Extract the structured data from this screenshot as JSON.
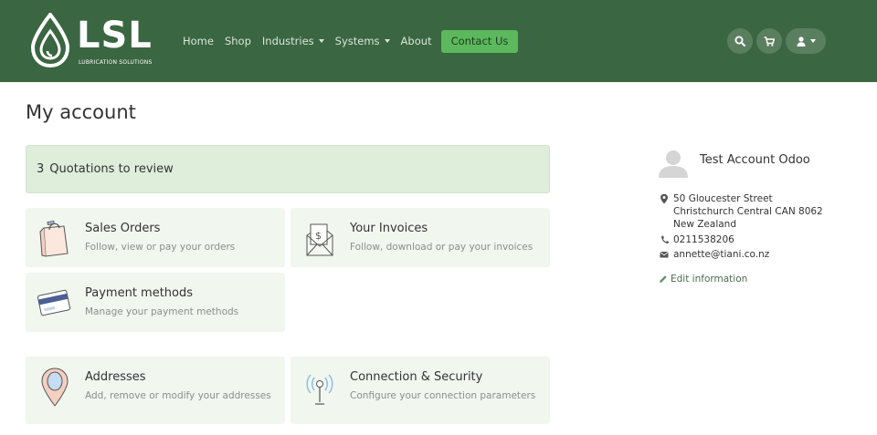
{
  "brand": {
    "name": "LSL",
    "tagline": "LUBRICATION SOLUTIONS"
  },
  "nav": {
    "items": [
      {
        "label": "Home"
      },
      {
        "label": "Shop"
      },
      {
        "label": "Industries"
      },
      {
        "label": "Systems"
      },
      {
        "label": "About"
      }
    ],
    "contact_label": "Contact Us",
    "icons": [
      "search-icon",
      "cart-icon",
      "user-icon"
    ]
  },
  "main": {
    "title": "My account",
    "alert": {
      "count": "3",
      "text": "Quotations to review"
    },
    "cards": [
      {
        "title": "Sales Orders",
        "desc": "Follow, view or pay your orders",
        "icon": "shopping-bag-icon"
      },
      {
        "title": "Your Invoices",
        "desc": "Follow, download or pay your invoices",
        "icon": "invoice-icon"
      },
      {
        "title": "Payment methods",
        "desc": "Manage your payment methods",
        "icon": "credit-card-icon"
      },
      {
        "title": "Addresses",
        "desc": "Add, remove or modify your addresses",
        "icon": "map-pin-icon"
      },
      {
        "title": "Connection & Security",
        "desc": "Configure your connection parameters",
        "icon": "antenna-icon"
      }
    ]
  },
  "sidebar": {
    "name": "Test Account Odoo",
    "address_lines": [
      "50 Gloucester Street",
      "Christchurch Central CAN 8062",
      "New Zealand"
    ],
    "phone": "0211538206",
    "email": "annette@tiani.co.nz",
    "edit_label": "Edit information"
  },
  "colors": {
    "header_bg": "#3a6641",
    "accent": "#5cb85c",
    "card_bg": "#f1f6ef",
    "alert_bg": "#deeedb"
  }
}
